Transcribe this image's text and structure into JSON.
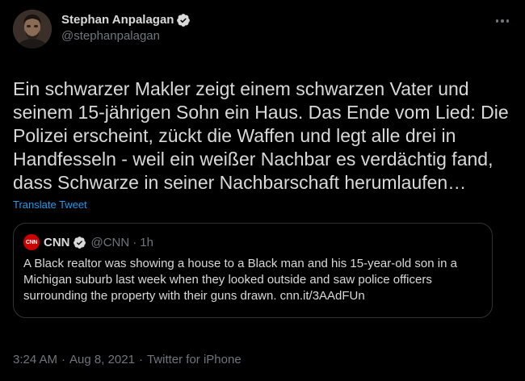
{
  "author": {
    "display_name": "Stephan Anpalagan",
    "handle": "@stephanpalagan",
    "verified": true
  },
  "tweet": {
    "text": "Ein schwarzer Makler zeigt einem schwarzen Vater und seinem 15-jährigen Sohn ein Haus. Das Ende vom Lied: Die Polizei erscheint, zückt die Waffen und legt alle drei in Handfesseln - weil ein weißer Nachbar es verdächtig fand, dass Schwarze in seiner Nachbarschaft herumlaufen…",
    "translate_label": "Translate Tweet"
  },
  "quote": {
    "logo_text": "CNN",
    "display_name": "CNN",
    "handle": "@CNN",
    "separator": "·",
    "time": "1h",
    "text": "A Black realtor was showing a house to a Black man and his 15-year-old son in a Michigan suburb last week when they looked outside and saw police officers surrounding the property with their guns drawn. cnn.it/3AAdFUn"
  },
  "meta": {
    "time": "3:24 AM",
    "separator": "·",
    "date": "Aug 8, 2021",
    "source": "Twitter for iPhone"
  },
  "colors": {
    "background": "#000000",
    "text": "#D9D9D9",
    "secondary": "#6E767D",
    "link": "#1D9BF0",
    "border": "#2F3336",
    "cnn_red": "#CC0000"
  },
  "icons": {
    "verified": "verified-badge-icon",
    "more": "more-options-icon"
  }
}
